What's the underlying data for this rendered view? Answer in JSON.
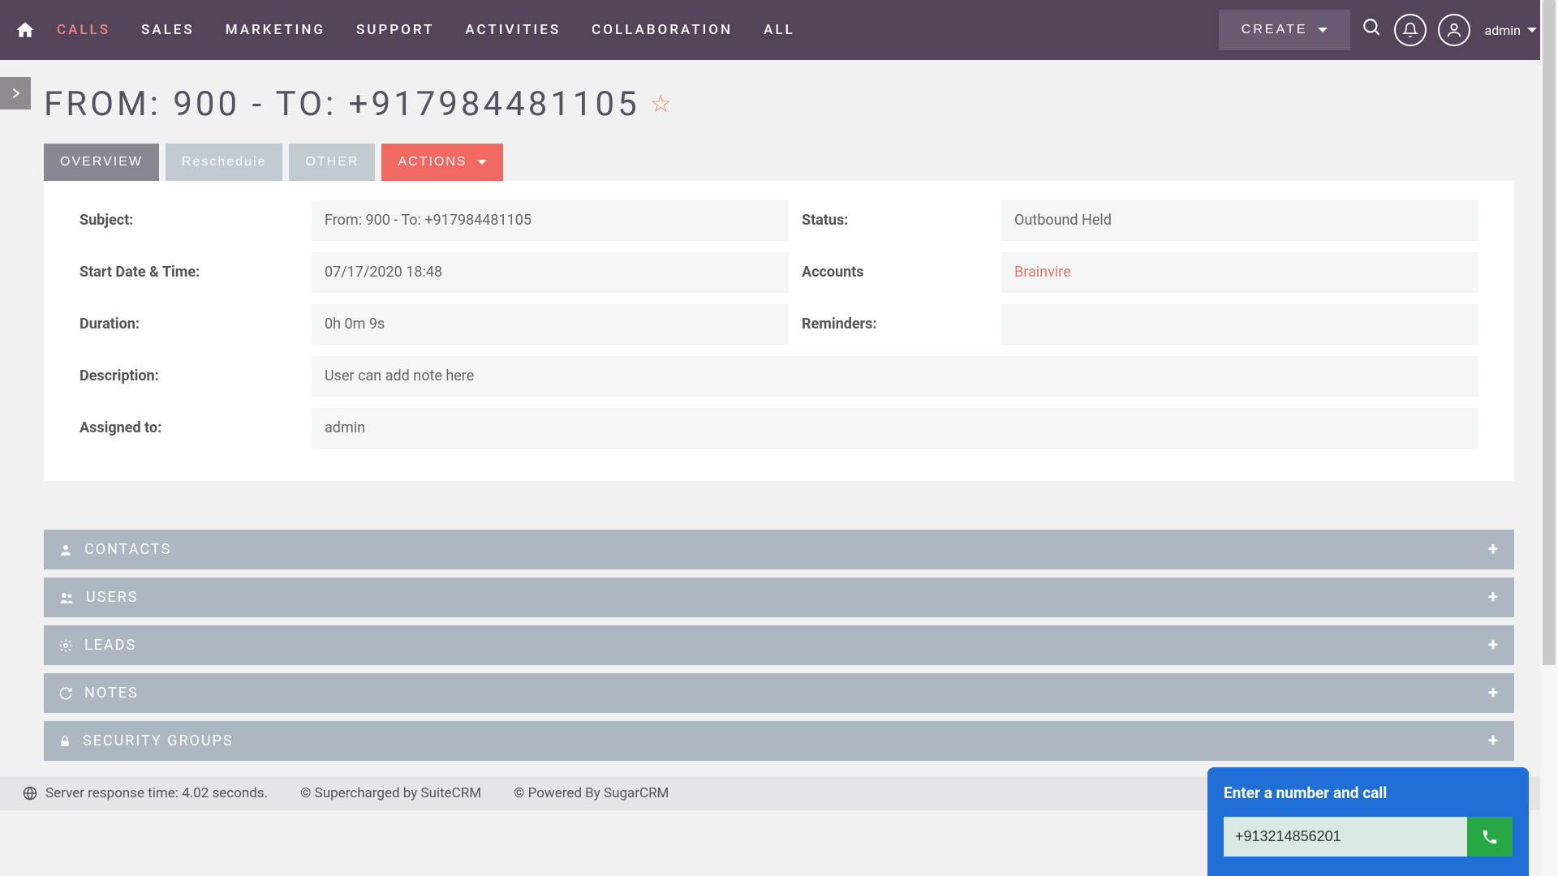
{
  "nav": {
    "items": [
      "CALLS",
      "SALES",
      "MARKETING",
      "SUPPORT",
      "ACTIVITIES",
      "COLLABORATION",
      "ALL"
    ],
    "active_index": 0,
    "create_label": "CREATE",
    "username": "admin"
  },
  "record": {
    "title": "FROM: 900 - TO: +917984481105",
    "tabs": {
      "overview": "OVERVIEW",
      "reschedule": "Reschedule",
      "other": "OTHER",
      "actions": "ACTIONS"
    },
    "fields": {
      "subject_label": "Subject:",
      "subject_value": "From: 900 - To: +917984481105",
      "status_label": "Status:",
      "status_value": "Outbound Held",
      "start_label": "Start Date & Time:",
      "start_value": "07/17/2020 18:48",
      "accounts_label": "Accounts",
      "accounts_value": "Brainvire",
      "duration_label": "Duration:",
      "duration_value": "0h 0m 9s",
      "reminders_label": "Reminders:",
      "reminders_value": "",
      "description_label": "Description:",
      "description_value": "User can add note here",
      "assigned_label": "Assigned to:",
      "assigned_value": "admin"
    }
  },
  "related": {
    "items": [
      {
        "label": "CONTACTS",
        "icon": "person"
      },
      {
        "label": "USERS",
        "icon": "people"
      },
      {
        "label": "LEADS",
        "icon": "gear"
      },
      {
        "label": "NOTES",
        "icon": "refresh"
      },
      {
        "label": "SECURITY GROUPS",
        "icon": "lock"
      }
    ]
  },
  "footer": {
    "response_time": "Server response time: 4.02 seconds.",
    "supercharged": "© Supercharged by SuiteCRM",
    "powered": "© Powered By SugarCRM"
  },
  "call_widget": {
    "title": "Enter a number and call",
    "value": "+913214856201"
  }
}
